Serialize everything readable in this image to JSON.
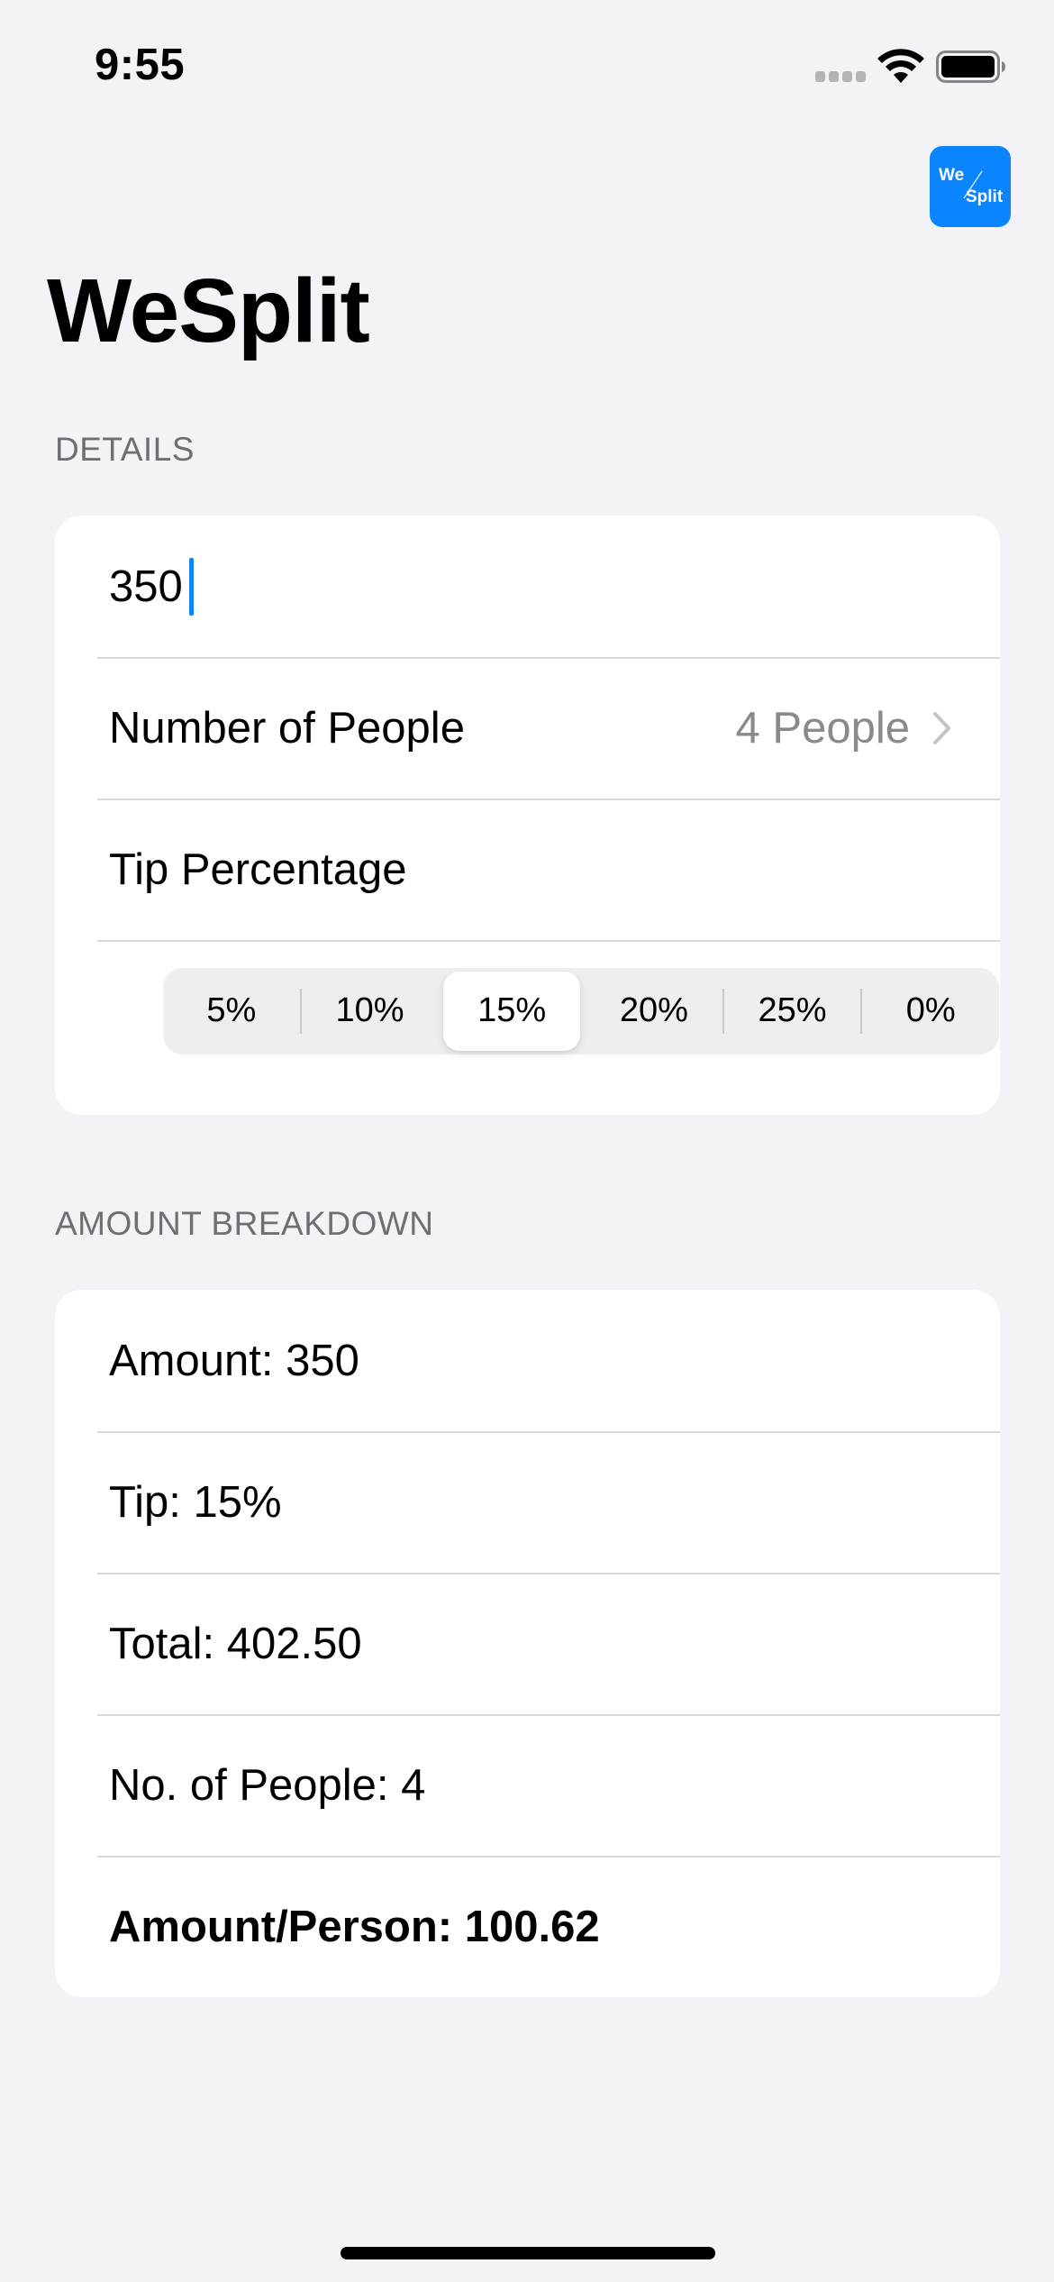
{
  "status_bar": {
    "time": "9:55"
  },
  "app_icon": {
    "text_top": "We",
    "text_bottom": "Split",
    "color": "#0a84ff"
  },
  "nav": {
    "title": "WeSplit"
  },
  "details_section": {
    "header": "DETAILS",
    "amount_value": "350",
    "people_label": "Number of People",
    "people_value": "4 People",
    "tip_label": "Tip Percentage",
    "tip_options": [
      "5%",
      "10%",
      "15%",
      "20%",
      "25%",
      "0%"
    ],
    "tip_selected": "15%"
  },
  "breakdown_section": {
    "header": "AMOUNT BREAKDOWN",
    "amount": "Amount: 350",
    "tip": "Tip: 15%",
    "total": "Total: 402.50",
    "people": "No. of People: 4",
    "per_person": "Amount/Person: 100.62"
  },
  "colors": {
    "accent": "#0a84ff",
    "background": "#f2f2f7",
    "secondary_text": "#6e6e73"
  }
}
